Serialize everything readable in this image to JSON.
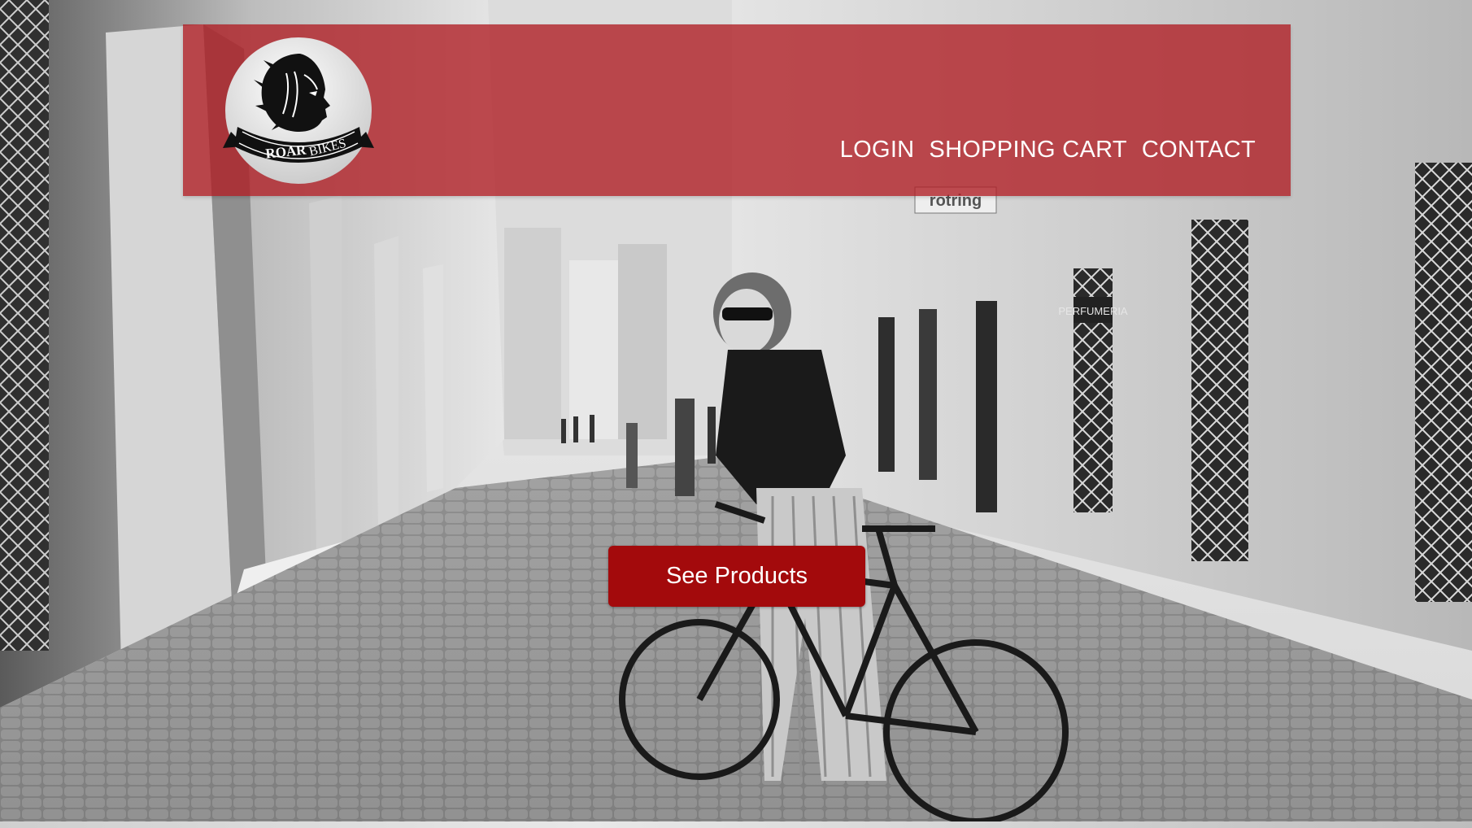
{
  "brand": {
    "logo_text_bold": "ROAR",
    "logo_text_light": "BIKES",
    "logo_icon": "lion-head-icon"
  },
  "nav": {
    "items": [
      {
        "label": "LOGIN"
      },
      {
        "label": "SHOPPING CART"
      },
      {
        "label": "CONTACT"
      }
    ]
  },
  "hero": {
    "cta_label": "See Products",
    "signs": {
      "shop_sign": "rotring",
      "store_sign": "PERFUMERIA"
    }
  },
  "colors": {
    "header_bar": "#b01c22",
    "cta_background": "#a30a0c",
    "nav_text": "#ffffff"
  }
}
